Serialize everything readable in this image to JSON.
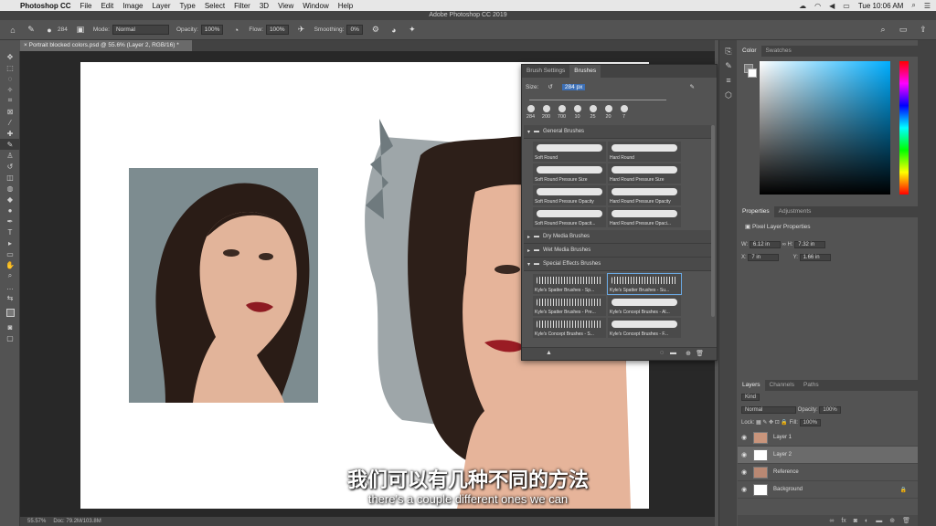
{
  "menubar": {
    "app_name": "Photoshop CC",
    "items": [
      "File",
      "Edit",
      "Image",
      "Layer",
      "Type",
      "Select",
      "Filter",
      "3D",
      "View",
      "Window",
      "Help"
    ],
    "clock": "Tue 10:06 AM"
  },
  "window_title": "Adobe Photoshop CC 2019",
  "options_bar": {
    "brush_size": "284",
    "mode_label": "Mode:",
    "mode_value": "Normal",
    "opacity_label": "Opacity:",
    "opacity_value": "100%",
    "flow_label": "Flow:",
    "flow_value": "100%",
    "smoothing_label": "Smoothing:",
    "smoothing_value": "0%"
  },
  "document_tab": "Portrait blocked colors.psd @ 55.6% (Layer 2, RGB/16) *",
  "status_bar": {
    "zoom": "55.57%",
    "doc": "Doc: 79.2M/103.8M"
  },
  "brushes_panel": {
    "tabs": [
      "Brush Settings",
      "Brushes"
    ],
    "size_label": "Size:",
    "size_value": "284 px",
    "presets": [
      "284",
      "200",
      "700",
      "10",
      "25",
      "20",
      "7"
    ],
    "groups": [
      {
        "name": "General Brushes",
        "brushes": [
          "Soft Round",
          "Hard Round",
          "Soft Round Pressure Size",
          "Hard Round Pressure Size",
          "Soft Round Pressure Opacity",
          "Hard Round Pressure Opacity",
          "Soft Round Pressure Opacit...",
          "Hard Round Pressure Opaci..."
        ]
      },
      {
        "name": "Dry Media Brushes",
        "brushes": []
      },
      {
        "name": "Wet Media Brushes",
        "brushes": []
      },
      {
        "name": "Special Effects Brushes",
        "brushes": [
          "Kyle's Spatter Brushes - Sp...",
          "Kyle's Spatter Brushes - Su...",
          "Kyle's Spatter Brushes - Pre...",
          "Kyle's Concept Brushes - Al...",
          "Kyle's Concept Brushes - S...",
          "Kyle's Concept Brushes - F..."
        ]
      }
    ]
  },
  "right_panels": {
    "color_tabs": [
      "Color",
      "Swatches"
    ],
    "props_tabs": [
      "Properties",
      "Adjustments"
    ],
    "props_title": "Pixel Layer Properties",
    "w_label": "W:",
    "w_value": "6.12 in",
    "h_label": "H:",
    "h_value": "7.32 in",
    "x_label": "X:",
    "x_value": "7 in",
    "y_label": "Y:",
    "y_value": "1.66 in",
    "layers_tabs": [
      "Layers",
      "Channels",
      "Paths"
    ],
    "kind": "Kind",
    "blend": "Normal",
    "opacity_label": "Opacity:",
    "opacity_value": "100%",
    "lock_label": "Lock:",
    "fill_label": "Fill:",
    "fill_value": "100%",
    "layers": [
      "Layer 1",
      "Layer 2",
      "Reference",
      "Background"
    ]
  },
  "subtitles": {
    "zh": "我们可以有几种不同的方法",
    "en": "there's a couple different ones we can"
  }
}
